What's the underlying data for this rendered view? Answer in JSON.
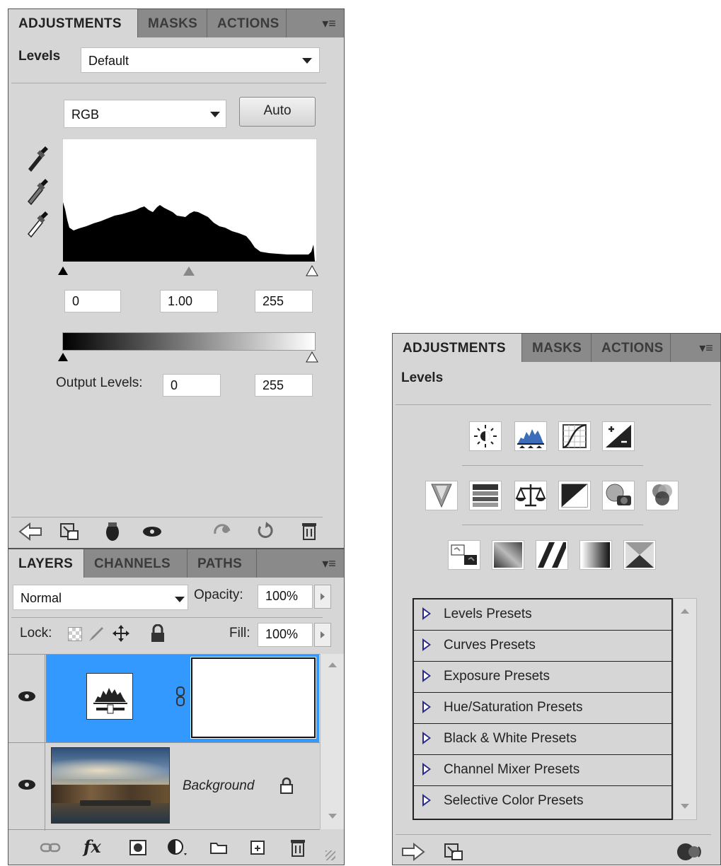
{
  "left_panel": {
    "tabs": [
      "ADJUSTMENTS",
      "MASKS",
      "ACTIONS"
    ],
    "adjustment_name": "Levels",
    "preset_value": "Default",
    "channel_value": "RGB",
    "auto_label": "Auto",
    "input_black": "0",
    "input_gamma": "1.00",
    "input_white": "255",
    "output_label": "Output Levels:",
    "output_black": "0",
    "output_white": "255"
  },
  "layers_panel": {
    "tabs": [
      "LAYERS",
      "CHANNELS",
      "PATHS"
    ],
    "blend_mode": "Normal",
    "opacity_label": "Opacity:",
    "opacity_value": "100%",
    "lock_label": "Lock:",
    "fill_label": "Fill:",
    "fill_value": "100%",
    "background_layer_name": "Background",
    "fx_label": "fx"
  },
  "right_panel": {
    "tabs": [
      "ADJUSTMENTS",
      "MASKS",
      "ACTIONS"
    ],
    "title": "Levels",
    "presets": [
      "Levels Presets",
      "Curves Presets",
      "Exposure Presets",
      "Hue/Saturation Presets",
      "Black & White Presets",
      "Channel Mixer Presets",
      "Selective Color Presets"
    ]
  },
  "colors": {
    "panel_bg": "#d6d6d6",
    "tabbar_bg": "#8a8a8a",
    "selected_layer": "#3399ff"
  }
}
